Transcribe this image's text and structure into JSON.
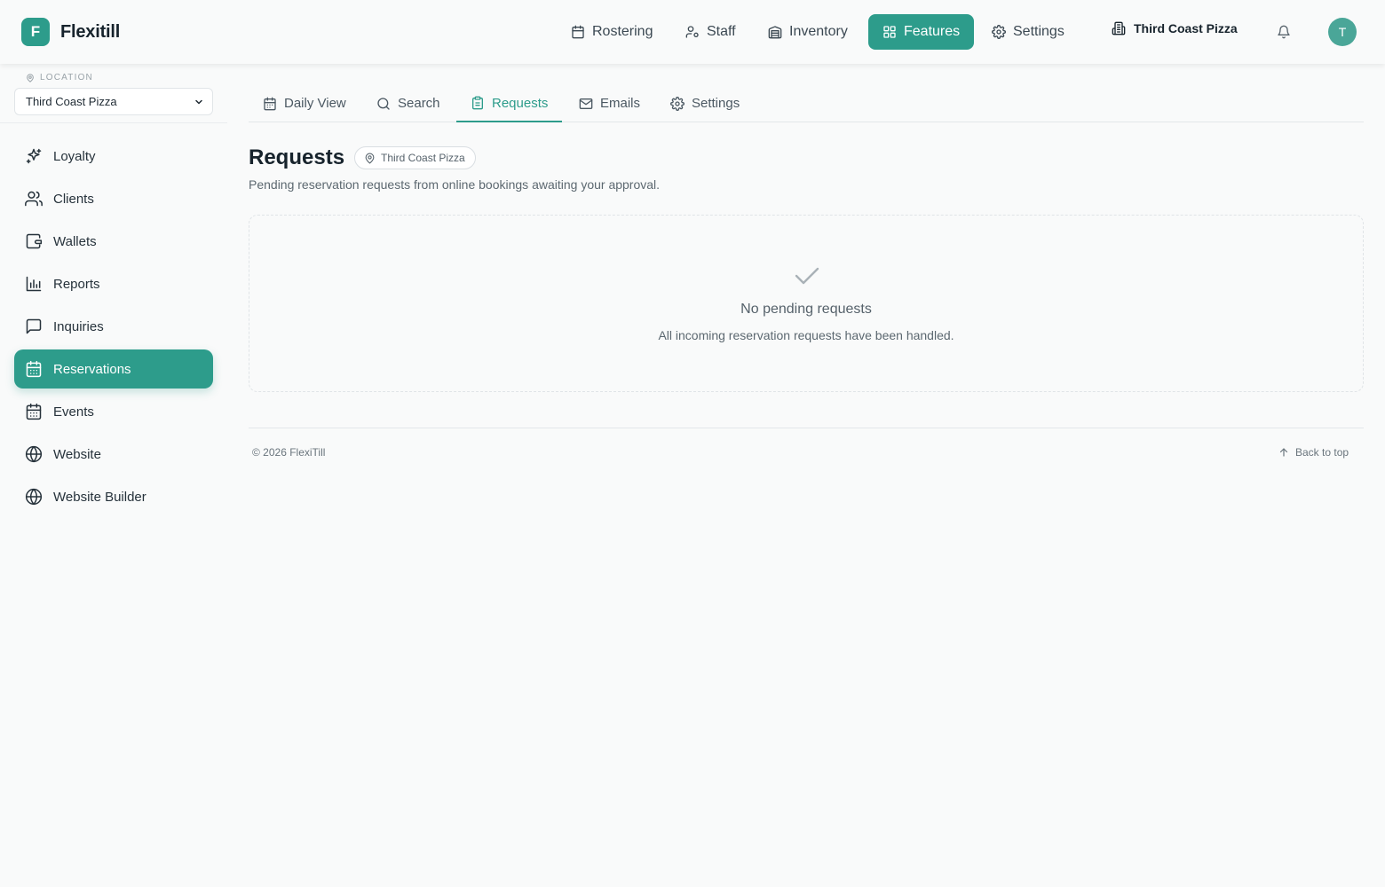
{
  "app": {
    "logo_letter": "F",
    "name": "Flexitill",
    "accent_color": "#2d9c8b"
  },
  "topnav": {
    "items": [
      {
        "label": "Rostering",
        "icon": "calendar-icon"
      },
      {
        "label": "Staff",
        "icon": "user-cog-icon"
      },
      {
        "label": "Inventory",
        "icon": "warehouse-icon"
      },
      {
        "label": "Features",
        "icon": "grid-icon",
        "active": true
      },
      {
        "label": "Settings",
        "icon": "gear-icon"
      }
    ],
    "location": "Third Coast Pizza",
    "avatar_initial": "T"
  },
  "sidebar": {
    "location_label": "LOCATION",
    "location_value": "Third Coast Pizza",
    "items": [
      {
        "label": "Loyalty",
        "icon": "sparkles-icon"
      },
      {
        "label": "Clients",
        "icon": "users-icon"
      },
      {
        "label": "Wallets",
        "icon": "wallet-icon"
      },
      {
        "label": "Reports",
        "icon": "bar-chart-icon"
      },
      {
        "label": "Inquiries",
        "icon": "message-square-icon"
      },
      {
        "label": "Reservations",
        "icon": "calendar-days-icon",
        "active": true
      },
      {
        "label": "Events",
        "icon": "calendar-days-icon"
      },
      {
        "label": "Website",
        "icon": "globe-icon"
      },
      {
        "label": "Website Builder",
        "icon": "globe-icon"
      }
    ]
  },
  "tabs": [
    {
      "label": "Daily View",
      "icon": "calendar-icon"
    },
    {
      "label": "Search",
      "icon": "search-icon"
    },
    {
      "label": "Requests",
      "icon": "clipboard-icon",
      "active": true
    },
    {
      "label": "Emails",
      "icon": "mail-icon"
    },
    {
      "label": "Settings",
      "icon": "gear-icon"
    }
  ],
  "main": {
    "title": "Requests",
    "location_chip": "Third Coast Pizza",
    "subtitle": "Pending reservation requests from online bookings awaiting your approval.",
    "empty_title": "No pending requests",
    "empty_subtitle": "All incoming reservation requests have been handled."
  },
  "footer": {
    "copyright": "© 2026 FlexiTill",
    "back_to_top": "Back to top"
  }
}
